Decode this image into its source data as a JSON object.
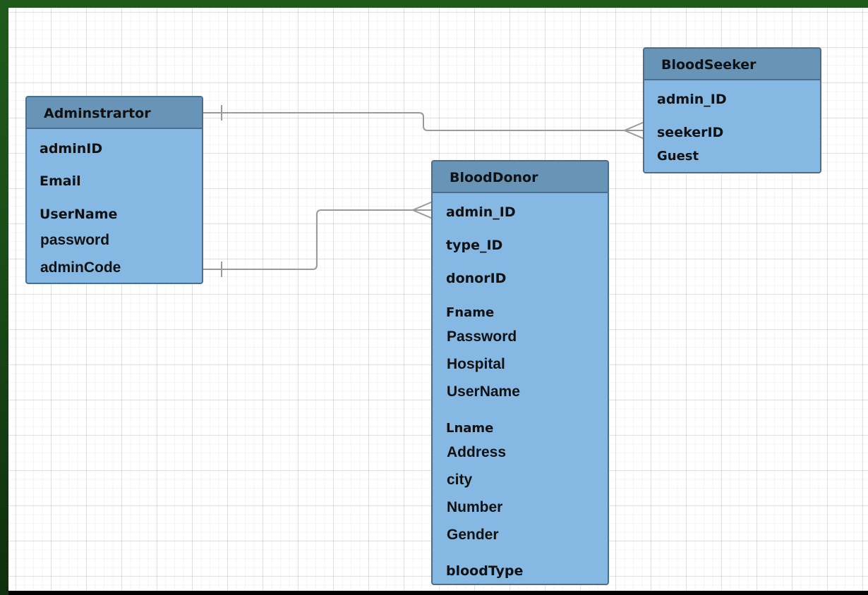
{
  "entities": {
    "administrator": {
      "title": "Adminstrartor",
      "attributes": [
        "adminID",
        "Email",
        "UserName",
        "password",
        "adminCode"
      ]
    },
    "bloodseeker": {
      "title": "BloodSeeker",
      "attributes": [
        "admin_ID",
        "seekerID",
        "Guest"
      ]
    },
    "blooddonor": {
      "title": "BloodDonor",
      "attributes": [
        "admin_ID",
        "type_ID",
        "donorID",
        "Fname",
        "Password",
        "Hospital",
        "UserName",
        "Lname",
        "Address",
        "city",
        "Number",
        "Gender",
        "bloodType"
      ]
    }
  },
  "relationships": [
    {
      "from": "Adminstrartor",
      "to": "BloodSeeker",
      "from_cardinality": "one",
      "to_cardinality": "many"
    },
    {
      "from": "Adminstrartor",
      "to": "BloodDonor",
      "from_cardinality": "one",
      "to_cardinality": "many"
    }
  ],
  "colors": {
    "header": "#6794b7",
    "body": "#85b9e3",
    "border": "#4a6e8c",
    "connector": "#9a9a9a",
    "frame": "#1f5a1b"
  }
}
